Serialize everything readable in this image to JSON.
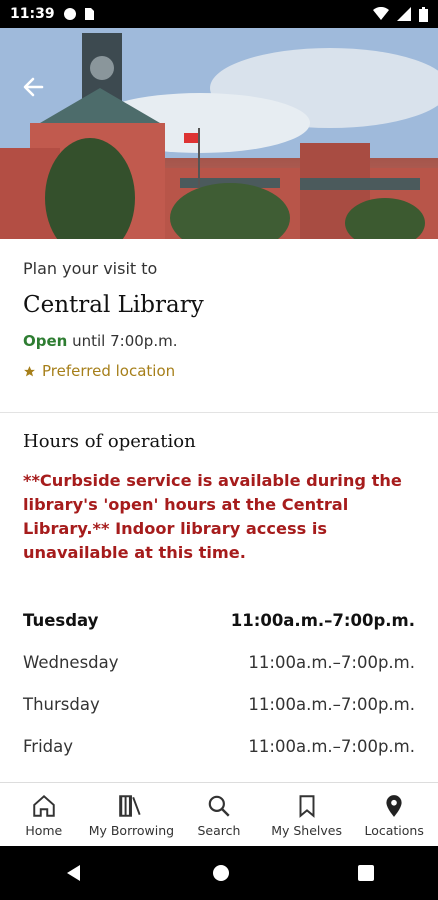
{
  "status_bar": {
    "time": "11:39"
  },
  "header": {
    "back_icon": "arrow-left-icon"
  },
  "place": {
    "plan_label": "Plan your visit to",
    "name": "Central Library",
    "open_status": "Open",
    "open_until": " until 7:00p.m.",
    "preferred_label": "Preferred location",
    "preferred_color": "#a67f1a"
  },
  "hours": {
    "title": "Hours of operation",
    "notice": "**Curbside service is available during the library's 'open' hours at the Central Library.** Indoor library access is unavailable at this time.",
    "rows": [
      {
        "day": "Tuesday",
        "time": "11:00a.m.–7:00p.m."
      },
      {
        "day": "Wednesday",
        "time": "11:00a.m.–7:00p.m."
      },
      {
        "day": "Thursday",
        "time": "11:00a.m.–7:00p.m."
      },
      {
        "day": "Friday",
        "time": "11:00a.m.–7:00p.m."
      }
    ]
  },
  "nav": {
    "items": [
      {
        "label": "Home",
        "icon": "home-icon"
      },
      {
        "label": "My Borrowing",
        "icon": "books-icon"
      },
      {
        "label": "Search",
        "icon": "search-icon"
      },
      {
        "label": "My Shelves",
        "icon": "bookmark-icon"
      },
      {
        "label": "Locations",
        "icon": "location-pin-icon"
      }
    ]
  },
  "colors": {
    "open": "#2e7d32",
    "notice": "#a61c1c"
  }
}
